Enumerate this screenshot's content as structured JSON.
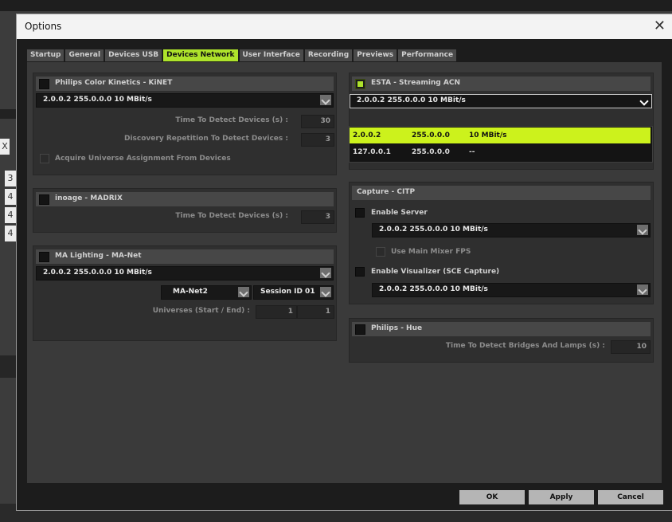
{
  "window": {
    "title": "Options",
    "close_glyph": "✕"
  },
  "background": {
    "cells": [
      "X",
      "3",
      "4",
      "4",
      "4"
    ],
    "tx": "TX"
  },
  "tabs": [
    {
      "label": "Startup",
      "active": false
    },
    {
      "label": "General",
      "active": false
    },
    {
      "label": "Devices USB",
      "active": false
    },
    {
      "label": "Devices Network",
      "active": true
    },
    {
      "label": "User Interface",
      "active": false
    },
    {
      "label": "Recording",
      "active": false
    },
    {
      "label": "Previews",
      "active": false
    },
    {
      "label": "Performance",
      "active": false
    }
  ],
  "kinet": {
    "title": "Philips Color Kinetics - KiNET",
    "enabled": false,
    "adapter": "2.0.0.2 255.0.0.0 10 MBit/s",
    "detect_label": "Time To Detect Devices (s) :",
    "detect_value": "30",
    "repetition_label": "Discovery Repetition To Detect Devices :",
    "repetition_value": "3",
    "acquire_label": "Acquire Universe Assignment From Devices"
  },
  "madrix": {
    "title": "inoage - MADRIX",
    "enabled": false,
    "detect_label": "Time To Detect Devices (s) :",
    "detect_value": "3"
  },
  "manet": {
    "title": "MA Lighting - MA-Net",
    "enabled": false,
    "adapter": "2.0.0.2 255.0.0.0 10 MBit/s",
    "protocol": "MA-Net2",
    "session": "Session ID 01",
    "universes_label": "Universes (Start / End) :",
    "universe_start": "1",
    "universe_end": "1"
  },
  "sacn": {
    "title": "ESTA - Streaming ACN",
    "enabled": true,
    "adapter": "2.0.0.2 255.0.0.0 10 MBit/s",
    "options": [
      {
        "ip": "2.0.0.2",
        "mask": "255.0.0.0",
        "speed": "10 MBit/s",
        "selected": true
      },
      {
        "ip": "127.0.0.1",
        "mask": "255.0.0.0",
        "speed": "--",
        "selected": false
      }
    ]
  },
  "citp": {
    "title": "Capture - CITP",
    "server_label": "Enable Server",
    "server_enabled": false,
    "server_adapter": "2.0.0.2 255.0.0.0 10 MBit/s",
    "mixer_fps_label": "Use Main Mixer FPS",
    "visualizer_label": "Enable Visualizer (SCE Capture)",
    "visualizer_enabled": false,
    "visualizer_adapter": "2.0.0.2 255.0.0.0 10 MBit/s"
  },
  "hue": {
    "title": "Philips - Hue",
    "enabled": false,
    "detect_label": "Time To Detect Bridges And Lamps (s) :",
    "detect_value": "10"
  },
  "buttons": {
    "ok": "OK",
    "apply": "Apply",
    "cancel": "Cancel"
  },
  "colors": {
    "accent": "#aee32b",
    "selection": "#ccf21c",
    "dialog_bg": "#1c1c1c",
    "panel_bg": "#2f2f2f"
  }
}
